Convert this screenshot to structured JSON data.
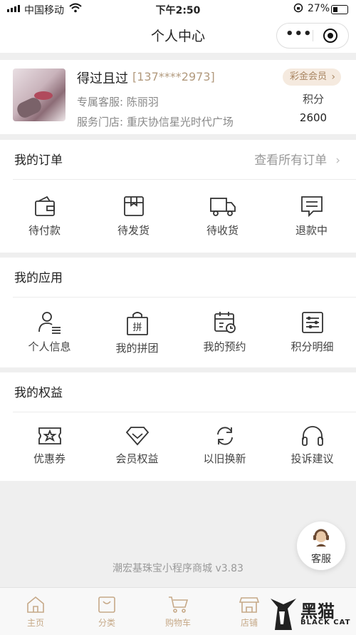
{
  "status_bar": {
    "carrier": "中国移动",
    "time": "下午2:50",
    "battery": "27%"
  },
  "nav": {
    "title": "个人中心"
  },
  "profile": {
    "name": "得过且过",
    "phone": "[137****2973]",
    "consultant": "专属客服: 陈丽羽",
    "store": "服务门店: 重庆协信星光时代广场",
    "member_level": "彩金会员",
    "points_label": "积分",
    "points_value": "2600"
  },
  "orders": {
    "title": "我的订单",
    "view_all": "查看所有订单",
    "items": [
      {
        "label": "待付款",
        "icon": "wallet-icon"
      },
      {
        "label": "待发货",
        "icon": "box-icon"
      },
      {
        "label": "待收货",
        "icon": "truck-icon"
      },
      {
        "label": "退款中",
        "icon": "message-icon"
      }
    ]
  },
  "apps": {
    "title": "我的应用",
    "items": [
      {
        "label": "个人信息",
        "icon": "user-list-icon"
      },
      {
        "label": "我的拼团",
        "icon": "group-buy-bag-icon"
      },
      {
        "label": "我的预约",
        "icon": "calendar-clock-icon"
      },
      {
        "label": "积分明细",
        "icon": "list-detail-icon"
      }
    ]
  },
  "benefits": {
    "title": "我的权益",
    "items": [
      {
        "label": "优惠券",
        "icon": "coupon-icon"
      },
      {
        "label": "会员权益",
        "icon": "diamond-icon"
      },
      {
        "label": "以旧换新",
        "icon": "refresh-icon"
      },
      {
        "label": "投诉建议",
        "icon": "headset-icon"
      }
    ]
  },
  "footer": {
    "version": "潮宏基珠宝小程序商城 v3.83"
  },
  "customer_service": {
    "label": "客服"
  },
  "tabbar": {
    "tabs": [
      {
        "label": "主页",
        "icon": "home-icon"
      },
      {
        "label": "分类",
        "icon": "category-bag-icon"
      },
      {
        "label": "购物车",
        "icon": "cart-icon"
      },
      {
        "label": "店铺",
        "icon": "store-icon"
      }
    ]
  },
  "watermark": {
    "brand": "黑猫",
    "sub": "BLACK CAT"
  },
  "colors": {
    "gold": "#c6a988",
    "member_bg": "#f5eadf",
    "phone": "#b29a7e"
  }
}
